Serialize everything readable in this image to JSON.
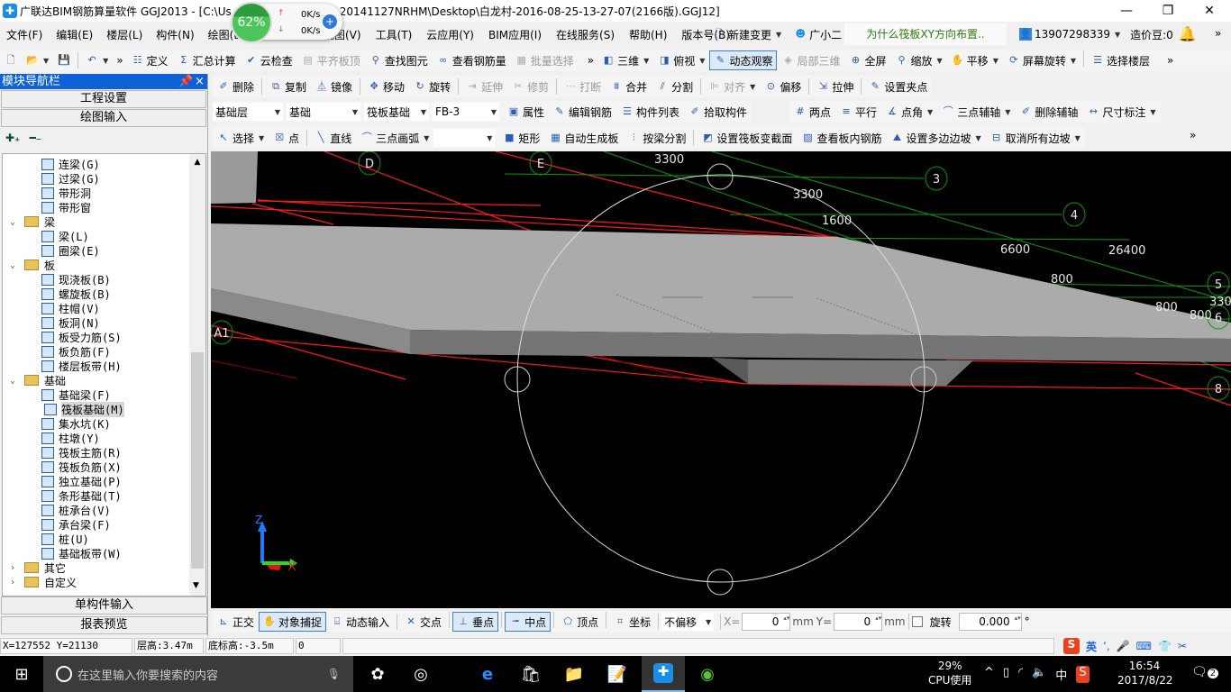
{
  "title": {
    "part1": "广联达BIM钢筋算量软件 GGJ2013 - [C:\\Us",
    "part2": "C-20141127NRHM\\Desktop\\白龙村-2016-08-25-13-27-07(2166版).GGJ12]"
  },
  "net_widget": {
    "percent": "62%",
    "up": "0K/s",
    "down": "0K/s"
  },
  "menu": {
    "left": [
      "文件(F)",
      "编辑(E)",
      "楼层(L)",
      "构件(N)",
      "绘图(D)"
    ],
    "right": [
      "视图(V)",
      "工具(T)",
      "云应用(Y)",
      "BIM应用(I)",
      "在线服务(S)",
      "帮助(H)",
      "版本号(B)"
    ],
    "new_change": "新建变更",
    "assistant": "广小二",
    "question": "为什么筏板XY方向布置..",
    "account": "13907298339",
    "beans": "造价豆:0"
  },
  "toolbar1": {
    "left": [
      {
        "label": "定义",
        "icon": "define-icon"
      },
      {
        "label": "汇总计算",
        "icon": "sigma-icon"
      },
      {
        "label": "云检查",
        "icon": "cloud-check-icon"
      },
      {
        "label": "平齐板顶",
        "icon": "align-top-icon",
        "disabled": true
      },
      {
        "label": "查找图元",
        "icon": "binoculars-icon"
      },
      {
        "label": "查看钢筋量",
        "icon": "glasses-icon"
      },
      {
        "label": "批量选择",
        "icon": "batch-select-icon",
        "disabled": true
      }
    ],
    "right": [
      {
        "label": "三维",
        "icon": "cube-icon",
        "dropdown": true
      },
      {
        "label": "俯视",
        "icon": "top-view-icon",
        "dropdown": true
      },
      {
        "label": "动态观察",
        "icon": "orbit-icon",
        "active": true
      },
      {
        "label": "局部三维",
        "icon": "local-3d-icon",
        "disabled": true
      },
      {
        "label": "全屏",
        "icon": "fullscreen-icon"
      },
      {
        "label": "缩放",
        "icon": "zoom-icon",
        "dropdown": true
      },
      {
        "label": "平移",
        "icon": "pan-icon",
        "dropdown": true
      },
      {
        "label": "屏幕旋转",
        "icon": "rotate-screen-icon",
        "dropdown": true
      },
      {
        "label": "选择楼层",
        "icon": "floor-select-icon"
      }
    ]
  },
  "toolbar2": [
    {
      "label": "删除",
      "icon": "delete-icon"
    },
    {
      "label": "复制",
      "icon": "copy-icon"
    },
    {
      "label": "镜像",
      "icon": "mirror-icon"
    },
    {
      "label": "移动",
      "icon": "move-icon"
    },
    {
      "label": "旋转",
      "icon": "rotate-icon"
    },
    {
      "label": "延伸",
      "icon": "extend-icon",
      "disabled": true
    },
    {
      "label": "修剪",
      "icon": "trim-icon",
      "disabled": true
    },
    {
      "label": "打断",
      "icon": "break-icon",
      "disabled": true
    },
    {
      "label": "合并",
      "icon": "merge-icon"
    },
    {
      "label": "分割",
      "icon": "split-icon"
    },
    {
      "label": "对齐",
      "icon": "align-icon",
      "disabled": true,
      "dropdown": true
    },
    {
      "label": "偏移",
      "icon": "offset-icon"
    },
    {
      "label": "拉伸",
      "icon": "stretch-icon"
    },
    {
      "label": "设置夹点",
      "icon": "grip-icon"
    }
  ],
  "toolbar3": {
    "selects": [
      "基础层",
      "基础",
      "筏板基础",
      "FB-3"
    ],
    "items": [
      {
        "label": "属性",
        "icon": "properties-icon"
      },
      {
        "label": "编辑钢筋",
        "icon": "edit-rebar-icon"
      },
      {
        "label": "构件列表",
        "icon": "list-icon"
      },
      {
        "label": "拾取构件",
        "icon": "pick-icon"
      }
    ],
    "axis_items": [
      {
        "label": "两点",
        "icon": "two-point-axis-icon"
      },
      {
        "label": "平行",
        "icon": "parallel-icon"
      },
      {
        "label": "点角",
        "icon": "point-angle-icon",
        "dropdown": true
      },
      {
        "label": "三点辅轴",
        "icon": "three-point-axis-icon",
        "dropdown": true
      },
      {
        "label": "删除辅轴",
        "icon": "delete-axis-icon"
      },
      {
        "label": "尺寸标注",
        "icon": "dimension-icon",
        "dropdown": true
      }
    ]
  },
  "toolbar4": [
    {
      "label": "选择",
      "icon": "cursor-icon",
      "dropdown": true
    },
    {
      "label": "点",
      "icon": "point-icon"
    },
    {
      "label": "直线",
      "icon": "line-icon"
    },
    {
      "label": "三点画弧",
      "icon": "arc-icon",
      "dropdown": true
    },
    {
      "label": "",
      "icon": "",
      "select": true
    },
    {
      "label": "矩形",
      "icon": "rectangle-icon"
    },
    {
      "label": "自动生成板",
      "icon": "auto-slab-icon"
    },
    {
      "label": "按梁分割",
      "icon": "split-by-beam-icon"
    },
    {
      "label": "设置筏板变截面",
      "icon": "variable-section-icon"
    },
    {
      "label": "查看板内钢筋",
      "icon": "view-rebar-icon"
    },
    {
      "label": "设置多边边坡",
      "icon": "slope-icon",
      "dropdown": true
    },
    {
      "label": "取消所有边坡",
      "icon": "cancel-slope-icon",
      "dropdown": true
    }
  ],
  "nav": {
    "title": "模块导航栏",
    "project_settings": "工程设置",
    "drawing_input": "绘图输入",
    "single_input": "单构件输入",
    "report_preview": "报表预览",
    "tree": [
      {
        "label": "连梁(G)",
        "level": 1
      },
      {
        "label": "过梁(G)",
        "level": 1
      },
      {
        "label": "带形洞",
        "level": 1
      },
      {
        "label": "带形窗",
        "level": 1
      },
      {
        "label": "梁",
        "level": 0,
        "expanded": true
      },
      {
        "label": "梁(L)",
        "level": 1
      },
      {
        "label": "圈梁(E)",
        "level": 1
      },
      {
        "label": "板",
        "level": 0,
        "expanded": true
      },
      {
        "label": "现浇板(B)",
        "level": 1
      },
      {
        "label": "螺旋板(B)",
        "level": 1
      },
      {
        "label": "柱帽(V)",
        "level": 1
      },
      {
        "label": "板洞(N)",
        "level": 1
      },
      {
        "label": "板受力筋(S)",
        "level": 1
      },
      {
        "label": "板负筋(F)",
        "level": 1
      },
      {
        "label": "楼层板带(H)",
        "level": 1
      },
      {
        "label": "基础",
        "level": 0,
        "expanded": true
      },
      {
        "label": "基础梁(F)",
        "level": 1
      },
      {
        "label": "筏板基础(M)",
        "level": 1,
        "selected": true
      },
      {
        "label": "集水坑(K)",
        "level": 1
      },
      {
        "label": "柱墩(Y)",
        "level": 1
      },
      {
        "label": "筏板主筋(R)",
        "level": 1
      },
      {
        "label": "筏板负筋(X)",
        "level": 1
      },
      {
        "label": "独立基础(P)",
        "level": 1
      },
      {
        "label": "条形基础(T)",
        "level": 1
      },
      {
        "label": "桩承台(V)",
        "level": 1
      },
      {
        "label": "承台梁(F)",
        "level": 1
      },
      {
        "label": "桩(U)",
        "level": 1
      },
      {
        "label": "基础板带(W)",
        "level": 1
      },
      {
        "label": "其它",
        "level": 0,
        "expanded": false
      },
      {
        "label": "自定义",
        "level": 0,
        "expanded": false
      }
    ]
  },
  "canvas": {
    "axis_labels": [
      "D",
      "E",
      "3",
      "4",
      "5",
      "6",
      "8",
      "A1"
    ],
    "dimensions": [
      "3300",
      "3300",
      "1600",
      "6600",
      "26400",
      "800",
      "800",
      "800",
      "330"
    ],
    "z_label": "Z"
  },
  "bottom_toolbar": {
    "items": [
      {
        "label": "正交",
        "icon": "ortho-icon"
      },
      {
        "label": "对象捕捉",
        "icon": "snap-icon",
        "active": true
      },
      {
        "label": "动态输入",
        "icon": "dynamic-input-icon"
      }
    ],
    "snaps": [
      {
        "label": "交点",
        "icon": "intersection-icon"
      },
      {
        "label": "垂点",
        "icon": "perpendicular-icon",
        "active": true
      },
      {
        "label": "中点",
        "icon": "midpoint-icon",
        "active": true
      },
      {
        "label": "顶点",
        "icon": "vertex-icon"
      },
      {
        "label": "坐标",
        "icon": "coordinate-icon"
      }
    ],
    "offset_mode": "不偏移",
    "x_label": "X=",
    "x_value": "0",
    "y_label": "Y=",
    "y_value": "0",
    "unit": "mm",
    "rotate_label": "旋转",
    "rotate_value": "0.000",
    "degree": "°"
  },
  "status": {
    "coords": "X=127552 Y=21130",
    "floor_height": "层高:3.47m",
    "base_elev": "底标高:-3.5m",
    "value": "0"
  },
  "taskbar": {
    "search_placeholder": "在这里输入你要搜索的内容",
    "cpu_percent": "29%",
    "cpu_label": "CPU使用",
    "ime": "中",
    "time": "16:54",
    "date": "2017/8/22",
    "notifications": "2",
    "sogou_lang": "英"
  }
}
